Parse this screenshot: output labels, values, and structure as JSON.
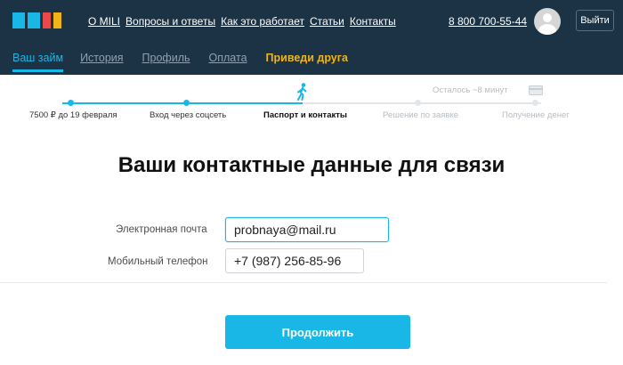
{
  "brand": {
    "colors": {
      "header_bg": "#1c3245",
      "accent": "#19b7e6",
      "promo": "#f1b417",
      "logo_red": "#e84a4a",
      "logo_yellow": "#f1b417"
    }
  },
  "nav": {
    "links": [
      {
        "label": "О MILI"
      },
      {
        "label": "Вопросы и ответы"
      },
      {
        "label": "Как это работает"
      },
      {
        "label": "Статьи"
      },
      {
        "label": "Контакты"
      }
    ],
    "phone": "8 800 700-55-44",
    "logout_label": "Выйти"
  },
  "tabs": [
    {
      "label": "Ваш займ",
      "active": true
    },
    {
      "label": "История",
      "active": false
    },
    {
      "label": "Профиль",
      "active": false
    },
    {
      "label": "Оплата",
      "active": false
    },
    {
      "label": "Приведи друга",
      "active": false,
      "promo": true
    }
  ],
  "progress": {
    "remaining": "Осталось ~8 минут",
    "current_step": 3,
    "steps": [
      {
        "label": "7500 ₽ до 19 февраля",
        "status": "done"
      },
      {
        "label": "Вход через соцсеть",
        "status": "done"
      },
      {
        "label": "Паспорт и контакты",
        "status": "current"
      },
      {
        "label": "Решение по заявке",
        "status": "pending"
      },
      {
        "label": "Получение денег",
        "status": "pending"
      }
    ],
    "icons": {
      "current": "walking-person-icon",
      "final": "bank-card-icon"
    }
  },
  "form": {
    "title": "Ваши контактные данные для связи",
    "email": {
      "label": "Электронная почта",
      "value": "probnaya@mail.ru"
    },
    "phone": {
      "label": "Мобильный телефон",
      "value": "+7 (987) 256-85-96"
    },
    "submit_label": "Продолжить"
  }
}
